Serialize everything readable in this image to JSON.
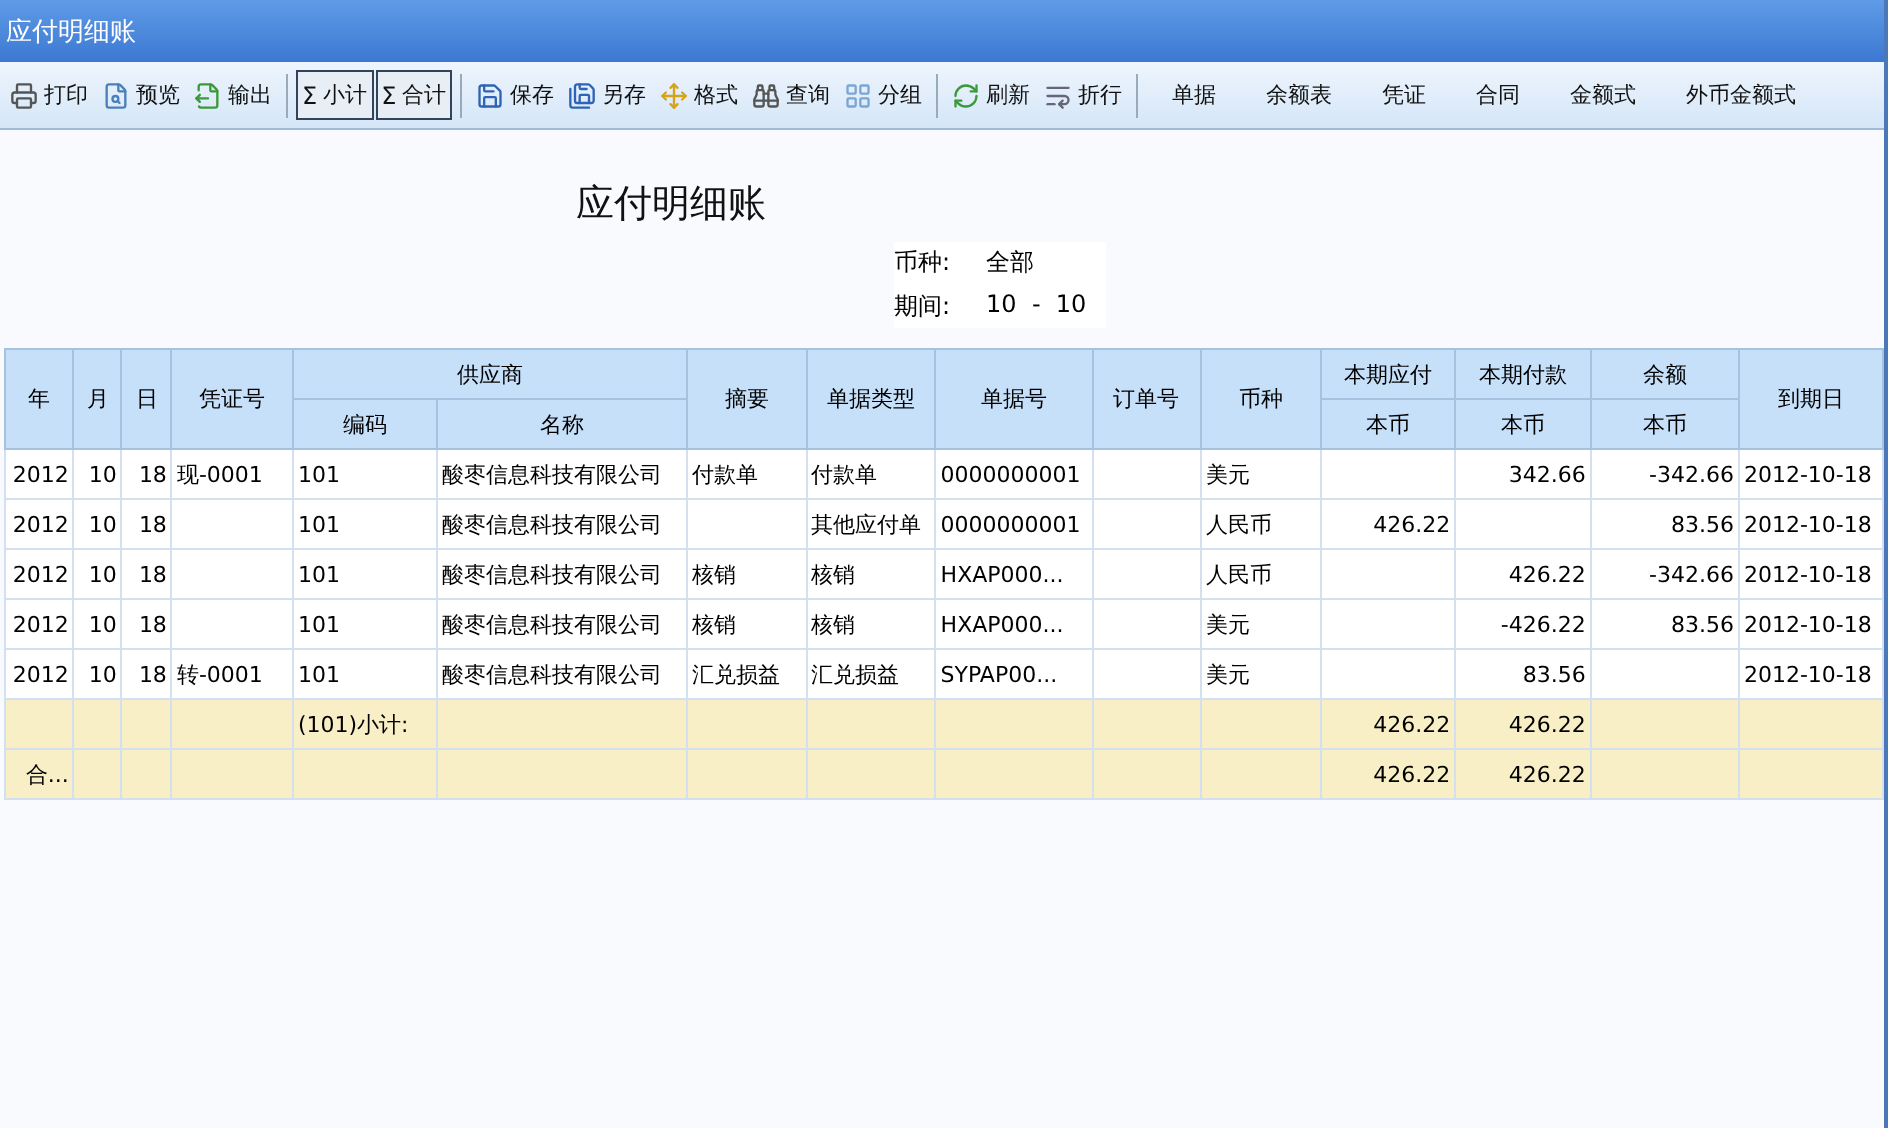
{
  "window": {
    "title": "应付明细账"
  },
  "toolbar": [
    {
      "kind": "icon",
      "label": "打印"
    },
    {
      "kind": "icon",
      "label": "预览"
    },
    {
      "kind": "icon",
      "label": "输出"
    },
    {
      "kind": "separator"
    },
    {
      "kind": "toggle",
      "label": "小计",
      "symbol": "Σ",
      "pressed": true
    },
    {
      "kind": "toggle",
      "label": "合计",
      "symbol": "Σ",
      "pressed": true
    },
    {
      "kind": "separator"
    },
    {
      "kind": "icon",
      "label": "保存"
    },
    {
      "kind": "icon",
      "label": "另存"
    },
    {
      "kind": "icon",
      "label": "格式"
    },
    {
      "kind": "icon",
      "label": "查询"
    },
    {
      "kind": "icon",
      "label": "分组"
    },
    {
      "kind": "separator"
    },
    {
      "kind": "icon",
      "label": "刷新"
    },
    {
      "kind": "icon",
      "label": "折行"
    },
    {
      "kind": "separator"
    },
    {
      "kind": "text",
      "label": "单据"
    },
    {
      "kind": "text",
      "label": "余额表"
    },
    {
      "kind": "text",
      "label": "凭证"
    },
    {
      "kind": "text",
      "label": "合同"
    },
    {
      "kind": "text",
      "label": "金额式"
    },
    {
      "kind": "text",
      "label": "外币金额式"
    }
  ],
  "report": {
    "title": "应付明细账",
    "filters": [
      {
        "label": "币种:",
        "value": "全部"
      },
      {
        "label": "期间:",
        "value": "10  -  10"
      }
    ]
  },
  "table": {
    "header": [
      {
        "label": "年"
      },
      {
        "label": "月"
      },
      {
        "label": "日"
      },
      {
        "label": "凭证号"
      },
      {
        "label": "供应商",
        "children": [
          {
            "label": "编码"
          },
          {
            "label": "名称"
          }
        ]
      },
      {
        "label": "摘要"
      },
      {
        "label": "单据类型"
      },
      {
        "label": "单据号"
      },
      {
        "label": "订单号"
      },
      {
        "label": "币种"
      },
      {
        "label": "本期应付",
        "children": [
          {
            "label": "本币"
          }
        ]
      },
      {
        "label": "本期付款",
        "children": [
          {
            "label": "本币"
          }
        ]
      },
      {
        "label": "余额",
        "children": [
          {
            "label": "本币"
          }
        ]
      },
      {
        "label": "到期日"
      }
    ],
    "rows": [
      {
        "kind": "data",
        "cells": [
          "2012",
          "10",
          "18",
          "现-0001",
          "101",
          "酸枣信息科技有限公司",
          "付款单",
          "付款单",
          "0000000001",
          null,
          "美元",
          null,
          "342.66",
          "-342.66",
          "2012-10-18"
        ]
      },
      {
        "kind": "data",
        "cells": [
          "2012",
          "10",
          "18",
          null,
          "101",
          "酸枣信息科技有限公司",
          null,
          "其他应付单",
          "0000000001",
          null,
          "人民币",
          "426.22",
          null,
          "83.56",
          "2012-10-18"
        ]
      },
      {
        "kind": "data",
        "cells": [
          "2012",
          "10",
          "18",
          null,
          "101",
          "酸枣信息科技有限公司",
          "核销",
          "核销",
          "HXAP000...",
          null,
          "人民币",
          null,
          "426.22",
          "-342.66",
          "2012-10-18"
        ]
      },
      {
        "kind": "data",
        "cells": [
          "2012",
          "10",
          "18",
          null,
          "101",
          "酸枣信息科技有限公司",
          "核销",
          "核销",
          "HXAP000...",
          null,
          "美元",
          null,
          "-426.22",
          "83.56",
          "2012-10-18"
        ]
      },
      {
        "kind": "data",
        "cells": [
          "2012",
          "10",
          "18",
          "转-0001",
          "101",
          "酸枣信息科技有限公司",
          "汇兑损益",
          "汇兑损益",
          "SYPAP00...",
          null,
          "美元",
          null,
          "83.56",
          null,
          "2012-10-18"
        ]
      },
      {
        "kind": "subtotal",
        "cells": [
          null,
          null,
          null,
          null,
          "(101)小计:",
          null,
          null,
          null,
          null,
          null,
          null,
          "426.22",
          "426.22",
          null,
          null
        ]
      },
      {
        "kind": "total",
        "cells": [
          "合...",
          null,
          null,
          null,
          null,
          null,
          null,
          null,
          null,
          null,
          null,
          "426.22",
          "426.22",
          null,
          null
        ]
      }
    ]
  }
}
